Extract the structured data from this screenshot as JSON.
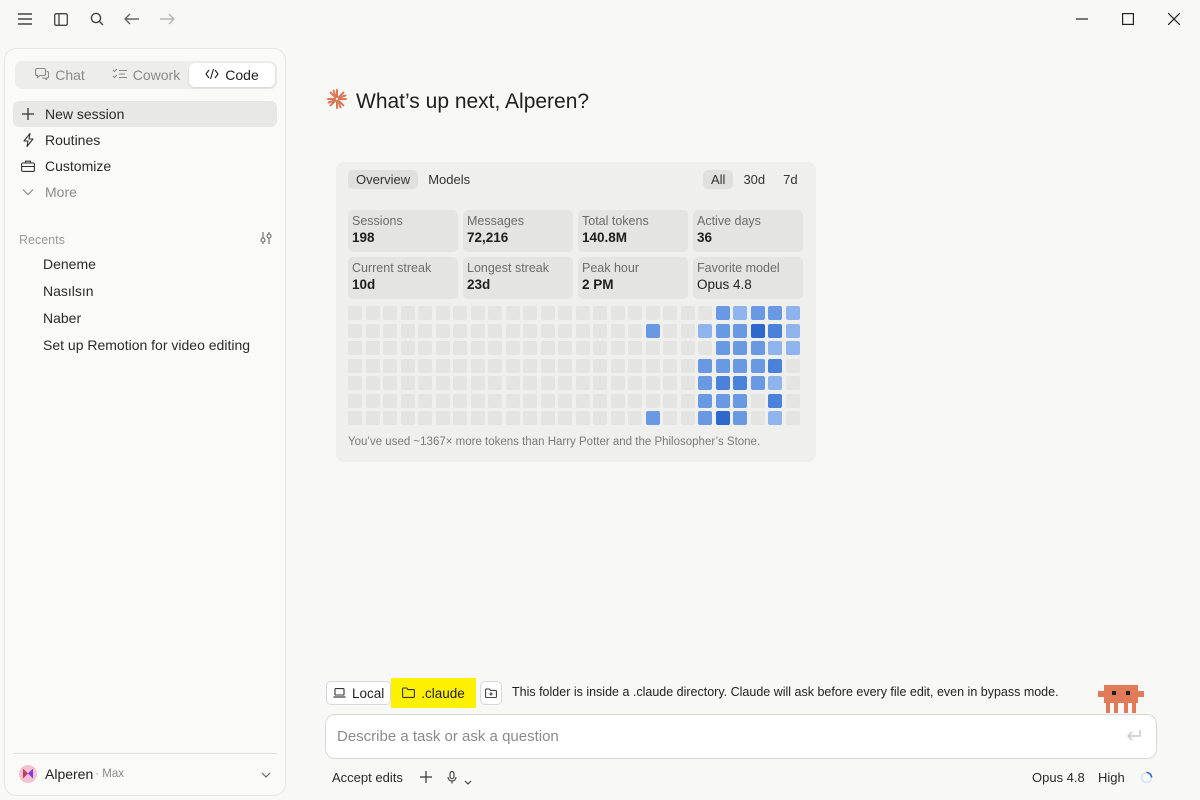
{
  "sidebar": {
    "modes": [
      {
        "label": "Chat",
        "icon": "chat-bubble-icon"
      },
      {
        "label": "Cowork",
        "icon": "checklist-icon"
      },
      {
        "label": "Code",
        "icon": "code-brackets-icon"
      }
    ],
    "active_mode": "Code",
    "nav": [
      {
        "label": "New session",
        "icon": "plus-icon"
      },
      {
        "label": "Routines",
        "icon": "lightning-icon"
      },
      {
        "label": "Customize",
        "icon": "briefcase-icon"
      },
      {
        "label": "More",
        "icon": "chevron-down-icon"
      }
    ],
    "recents_label": "Recents",
    "recents": [
      "Deneme",
      "Nasılsın",
      "Naber",
      "Set up Remotion for video editing"
    ],
    "user": {
      "name": "Alperen",
      "plan": " · Max"
    }
  },
  "main": {
    "greeting": "What’s up next, Alperen?",
    "stats": {
      "tabs": [
        "Overview",
        "Models"
      ],
      "active_tab": "Overview",
      "ranges": [
        "All",
        "30d",
        "7d"
      ],
      "active_range": "All",
      "tiles": [
        {
          "label": "Sessions",
          "value": "198"
        },
        {
          "label": "Messages",
          "value": "72,216"
        },
        {
          "label": "Total tokens",
          "value": "140.8M"
        },
        {
          "label": "Active days",
          "value": "36"
        },
        {
          "label": "Current streak",
          "value": "10d"
        },
        {
          "label": "Longest streak",
          "value": "23d"
        },
        {
          "label": "Peak hour",
          "value": "2 PM"
        },
        {
          "label": "Favorite model",
          "value": "Opus 4.8"
        }
      ],
      "heatmap_weeks": 26,
      "heatmap_active": [
        {
          "week": 17,
          "day": 1,
          "level": 2
        },
        {
          "week": 17,
          "day": 6,
          "level": 2
        },
        {
          "week": 20,
          "day": 1,
          "level": 1
        },
        {
          "week": 20,
          "day": 3,
          "level": 2
        },
        {
          "week": 20,
          "day": 4,
          "level": 2
        },
        {
          "week": 20,
          "day": 5,
          "level": 2
        },
        {
          "week": 20,
          "day": 6,
          "level": 2
        },
        {
          "week": 21,
          "day": 0,
          "level": 2
        },
        {
          "week": 21,
          "day": 1,
          "level": 2
        },
        {
          "week": 21,
          "day": 2,
          "level": 2
        },
        {
          "week": 21,
          "day": 3,
          "level": 2
        },
        {
          "week": 21,
          "day": 4,
          "level": 3
        },
        {
          "week": 21,
          "day": 5,
          "level": 2
        },
        {
          "week": 21,
          "day": 6,
          "level": 4
        },
        {
          "week": 22,
          "day": 0,
          "level": 1
        },
        {
          "week": 22,
          "day": 1,
          "level": 2
        },
        {
          "week": 22,
          "day": 2,
          "level": 2
        },
        {
          "week": 22,
          "day": 3,
          "level": 2
        },
        {
          "week": 22,
          "day": 4,
          "level": 3
        },
        {
          "week": 22,
          "day": 5,
          "level": 2
        },
        {
          "week": 22,
          "day": 6,
          "level": 2
        },
        {
          "week": 23,
          "day": 0,
          "level": 2
        },
        {
          "week": 23,
          "day": 1,
          "level": 4
        },
        {
          "week": 23,
          "day": 2,
          "level": 2
        },
        {
          "week": 23,
          "day": 3,
          "level": 2
        },
        {
          "week": 23,
          "day": 4,
          "level": 2
        },
        {
          "week": 24,
          "day": 0,
          "level": 2
        },
        {
          "week": 24,
          "day": 1,
          "level": 3
        },
        {
          "week": 24,
          "day": 2,
          "level": 1
        },
        {
          "week": 24,
          "day": 3,
          "level": 3
        },
        {
          "week": 24,
          "day": 4,
          "level": 1
        },
        {
          "week": 24,
          "day": 5,
          "level": 3
        },
        {
          "week": 24,
          "day": 6,
          "level": 1
        },
        {
          "week": 25,
          "day": 0,
          "level": 1
        },
        {
          "week": 25,
          "day": 1,
          "level": 1
        },
        {
          "week": 25,
          "day": 2,
          "level": 1
        }
      ],
      "footnote": "You’ve used ~1367× more tokens than Harry Potter and the Philosopher’s Stone."
    },
    "composer": {
      "env_label": "Local",
      "folder_label": ".claude",
      "notice": "This folder is inside a .claude directory. Claude will ask before every file edit, even in bypass mode.",
      "placeholder": "Describe a task or ask a question",
      "mode_label": "Accept edits",
      "model_label": "Opus 4.8",
      "effort_label": "High"
    }
  },
  "colors": {
    "accent": "#d97757",
    "highlight": "#fdf000",
    "heat_levels": [
      "#e4e4e2",
      "#8fb3ec",
      "#6a99e3",
      "#4a82db",
      "#2e68cc"
    ],
    "mascot": "#e07a57"
  }
}
